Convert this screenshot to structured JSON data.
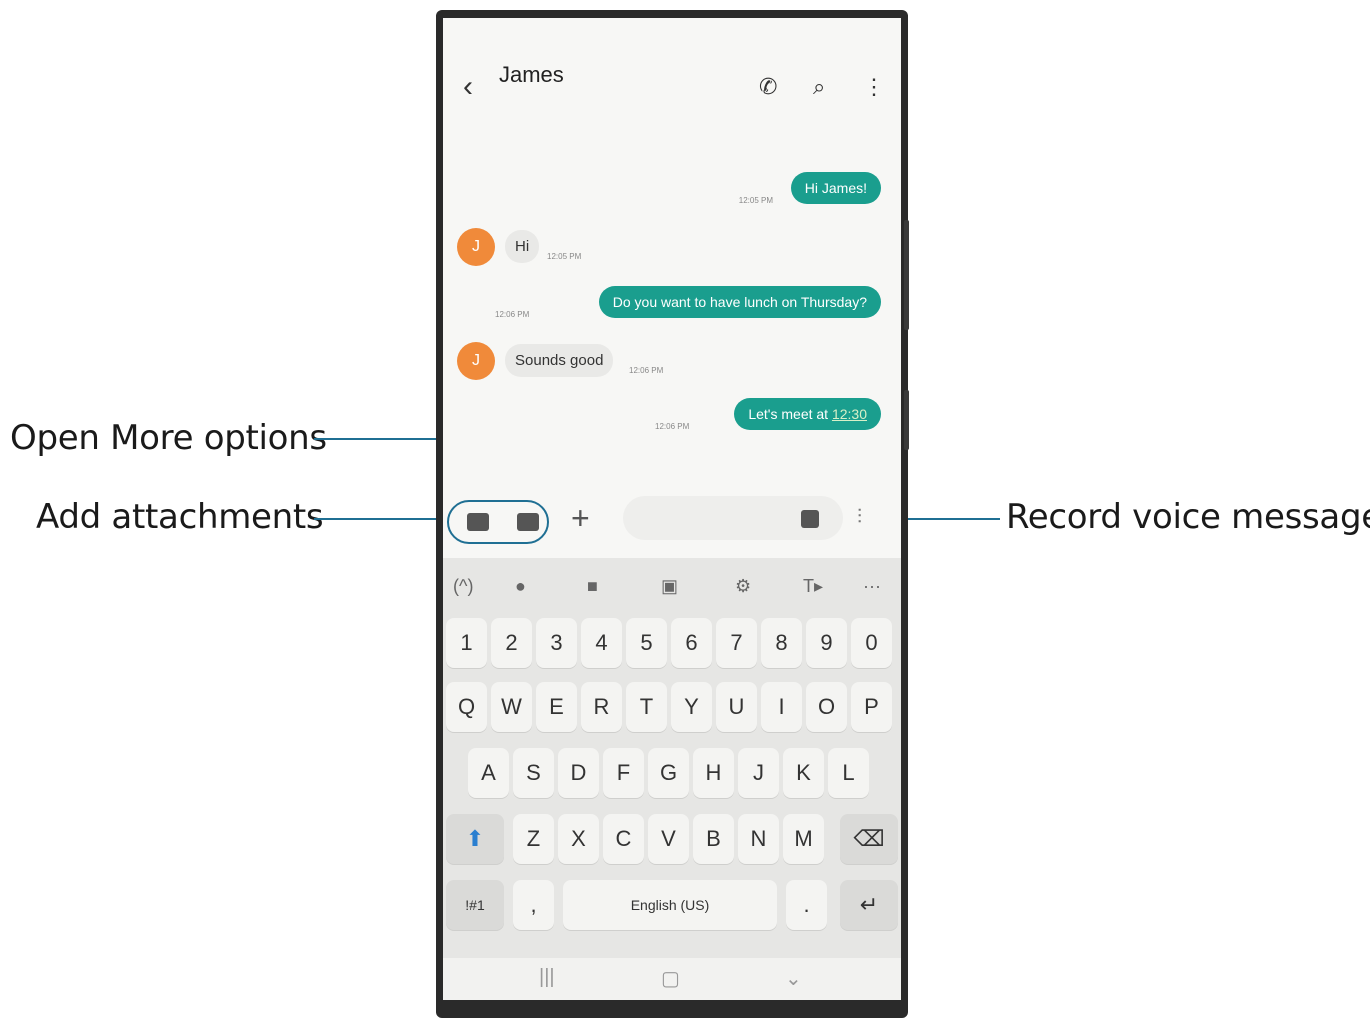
{
  "callouts": {
    "more_options": "Open More options",
    "attachments": "Add attachments",
    "voice": "Record voice message"
  },
  "header": {
    "back_icon": "chevron-left-icon",
    "contact": "James",
    "icons": [
      "phone-icon",
      "search-icon",
      "more-vert-icon"
    ]
  },
  "avatar_letter": "J",
  "messages": [
    {
      "dir": "out",
      "text": "Hi James!",
      "time": "12:05 PM"
    },
    {
      "dir": "in",
      "text": "Hi",
      "time": "12:05 PM"
    },
    {
      "dir": "out",
      "text": "Do you want to have lunch on Thursday?",
      "time": "12:06 PM"
    },
    {
      "dir": "in",
      "text": "Sounds good",
      "time": "12:06 PM"
    },
    {
      "dir": "out",
      "text_prefix": "Let's meet at ",
      "text_link": "12:30",
      "time": "12:06 PM"
    }
  ],
  "colors": {
    "accent": "#1a9e8e",
    "callout_line": "#1f6f93",
    "avatar": "#f08a3a"
  },
  "keyboard": {
    "toolbar": [
      "(^)",
      "●",
      "■",
      "▣",
      "⚙",
      "T▸",
      "···"
    ],
    "numbers": [
      "1",
      "2",
      "3",
      "4",
      "5",
      "6",
      "7",
      "8",
      "9",
      "0"
    ],
    "row1": [
      "Q",
      "W",
      "E",
      "R",
      "T",
      "Y",
      "U",
      "I",
      "O",
      "P"
    ],
    "row2": [
      "A",
      "S",
      "D",
      "F",
      "G",
      "H",
      "J",
      "K",
      "L"
    ],
    "row3": [
      "Z",
      "X",
      "C",
      "V",
      "B",
      "N",
      "M"
    ],
    "symbols": "!#1",
    "comma": ",",
    "space": "English (US)",
    "period": "."
  },
  "navbar": {
    "recent": "|||",
    "home": "▢",
    "back": "⌄"
  }
}
